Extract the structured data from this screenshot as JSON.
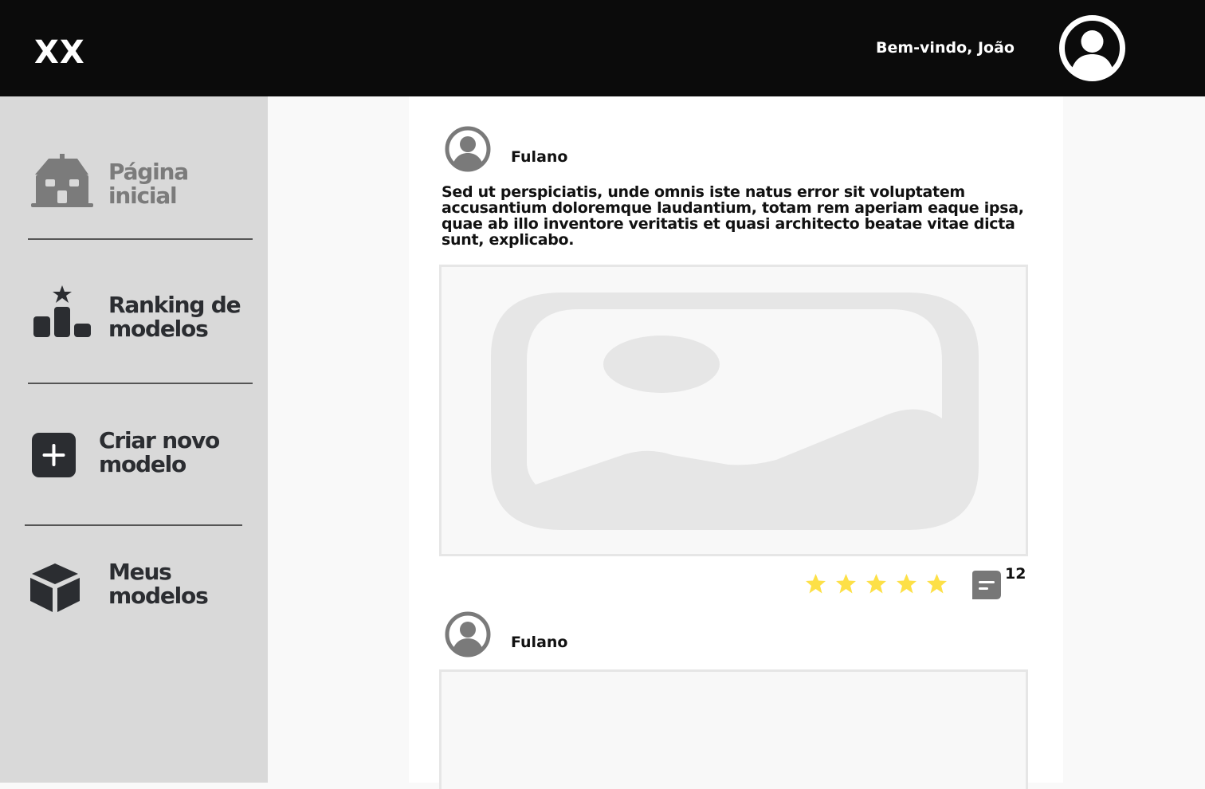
{
  "header": {
    "logo": "XX",
    "welcome": "Bem-vindo, João",
    "avatar_icon": "user-circle-icon"
  },
  "sidebar": {
    "items": [
      {
        "label": "Página inicial",
        "icon": "house-icon"
      },
      {
        "label": "Ranking de modelos",
        "icon": "podium-icon"
      },
      {
        "label": "Criar novo modelo",
        "icon": "plus-square-icon"
      },
      {
        "label": "Meus modelos",
        "icon": "cube-icon"
      }
    ]
  },
  "feed": {
    "posts": [
      {
        "author": "Fulano",
        "text": "Sed ut perspiciatis, unde omnis iste natus error sit voluptatem accusantium doloremque laudantium, totam rem aperiam eaque ipsa, quae ab illo inventore veritatis et quasi architecto beatae vitae dicta sunt, explicabo.",
        "image_icon": "image-placeholder-icon",
        "rating_stars": 5,
        "comment_count": "12"
      },
      {
        "author": "Fulano",
        "image_icon": "image-placeholder-icon"
      }
    ]
  },
  "colors": {
    "topbar": "#0b0b0b",
    "sidebar": "#d9d9d9",
    "star": "#fde047",
    "icon_dark": "#2b2d31",
    "icon_muted": "#7b7b7b"
  }
}
